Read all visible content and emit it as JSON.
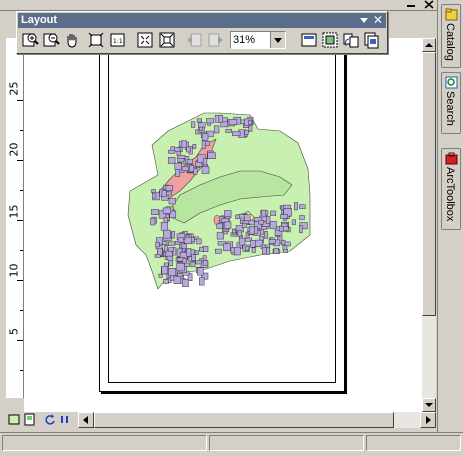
{
  "layout_toolbar": {
    "title": "Layout",
    "zoom_value": "31%",
    "buttons": [
      "zoom-in-icon",
      "zoom-out-icon",
      "pan-icon",
      "zoom-whole-page-icon",
      "zoom-100-icon",
      "fixed-zoom-in-icon",
      "fixed-zoom-out-icon",
      "go-back-extent-icon",
      "go-forward-extent-icon",
      "toggle-draft-mode-icon",
      "focus-data-frame-icon",
      "change-layout-icon",
      "data-driven-pages-icon"
    ]
  },
  "ruler": {
    "labels": [
      "25",
      "20",
      "15",
      "10",
      "5"
    ]
  },
  "right_dock": {
    "tabs": [
      {
        "label": "Catalog",
        "icon": "catalog-icon"
      },
      {
        "label": "Search",
        "icon": "search-icon"
      },
      {
        "label": "ArcToolbox",
        "icon": "toolbox-icon"
      }
    ]
  },
  "colors": {
    "map_green": "#c8f0b0",
    "map_parcels": "#b8a8e0",
    "map_pink": "#f0a0a0",
    "map_yellow": "#f0f0a0",
    "titlebar": "#5a6d8a"
  }
}
